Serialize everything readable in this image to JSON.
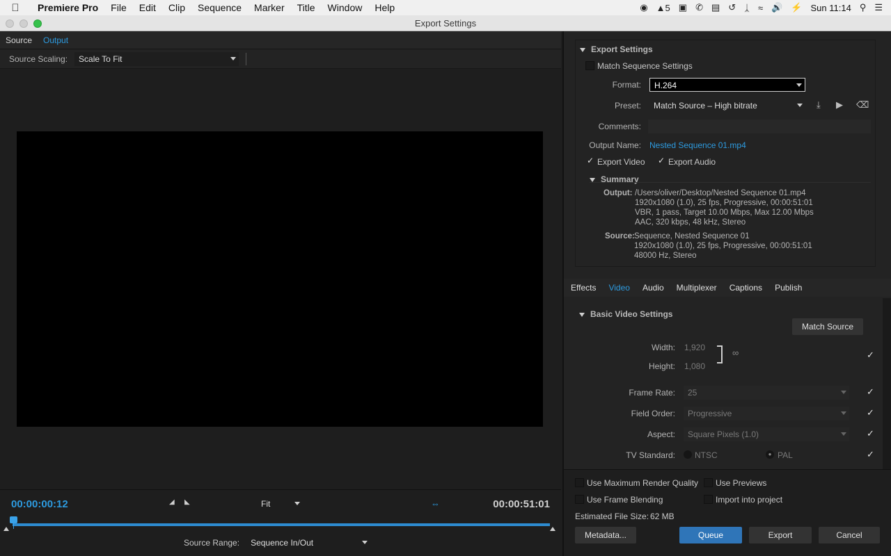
{
  "menubar": {
    "app_name": "Premiere Pro",
    "items": [
      "File",
      "Edit",
      "Clip",
      "Sequence",
      "Marker",
      "Title",
      "Window",
      "Help"
    ],
    "adobe_badge": "5",
    "clock": "Sun 11:14"
  },
  "window": {
    "title": "Export Settings"
  },
  "left": {
    "tabs": {
      "source": "Source",
      "output": "Output"
    },
    "source_scaling_label": "Source Scaling:",
    "source_scaling_value": "Scale To Fit",
    "current_time": "00:00:00:12",
    "duration": "00:00:51:01",
    "zoom": "Fit",
    "source_range_label": "Source Range:",
    "source_range_value": "Sequence In/Out"
  },
  "export_settings": {
    "header": "Export Settings",
    "match_sequence": "Match Sequence Settings",
    "format_label": "Format:",
    "format_value": "H.264",
    "preset_label": "Preset:",
    "preset_value": "Match Source – High bitrate",
    "comments_label": "Comments:",
    "output_name_label": "Output Name:",
    "output_name_value": "Nested Sequence 01.mp4",
    "export_video": "Export Video",
    "export_audio": "Export Audio",
    "summary": {
      "header": "Summary",
      "output_label": "Output:",
      "output_lines": [
        "/Users/oliver/Desktop/Nested Sequence 01.mp4",
        "1920x1080 (1.0), 25 fps, Progressive, 00:00:51:01",
        "VBR, 1 pass, Target 10.00 Mbps, Max 12.00 Mbps",
        "AAC, 320 kbps, 48 kHz, Stereo"
      ],
      "source_label": "Source:",
      "source_lines": [
        "Sequence, Nested Sequence 01",
        "1920x1080 (1.0), 25 fps, Progressive, 00:00:51:01",
        "48000 Hz, Stereo"
      ]
    }
  },
  "tabs": {
    "effects": "Effects",
    "video": "Video",
    "audio": "Audio",
    "multiplexer": "Multiplexer",
    "captions": "Captions",
    "publish": "Publish"
  },
  "video_settings": {
    "header": "Basic Video Settings",
    "match_source": "Match Source",
    "width_label": "Width:",
    "width_value": "1,920",
    "height_label": "Height:",
    "height_value": "1,080",
    "frame_rate_label": "Frame Rate:",
    "frame_rate_value": "25",
    "field_order_label": "Field Order:",
    "field_order_value": "Progressive",
    "aspect_label": "Aspect:",
    "aspect_value": "Square Pixels (1.0)",
    "tv_standard_label": "TV Standard:",
    "ntsc": "NTSC",
    "pal": "PAL"
  },
  "footer": {
    "max_render_quality": "Use Maximum Render Quality",
    "use_previews": "Use Previews",
    "frame_blending": "Use Frame Blending",
    "import_into_project": "Import into project",
    "file_size_label": "Estimated File Size:",
    "file_size_value": "62 MB",
    "metadata": "Metadata...",
    "queue": "Queue",
    "export": "Export",
    "cancel": "Cancel"
  }
}
